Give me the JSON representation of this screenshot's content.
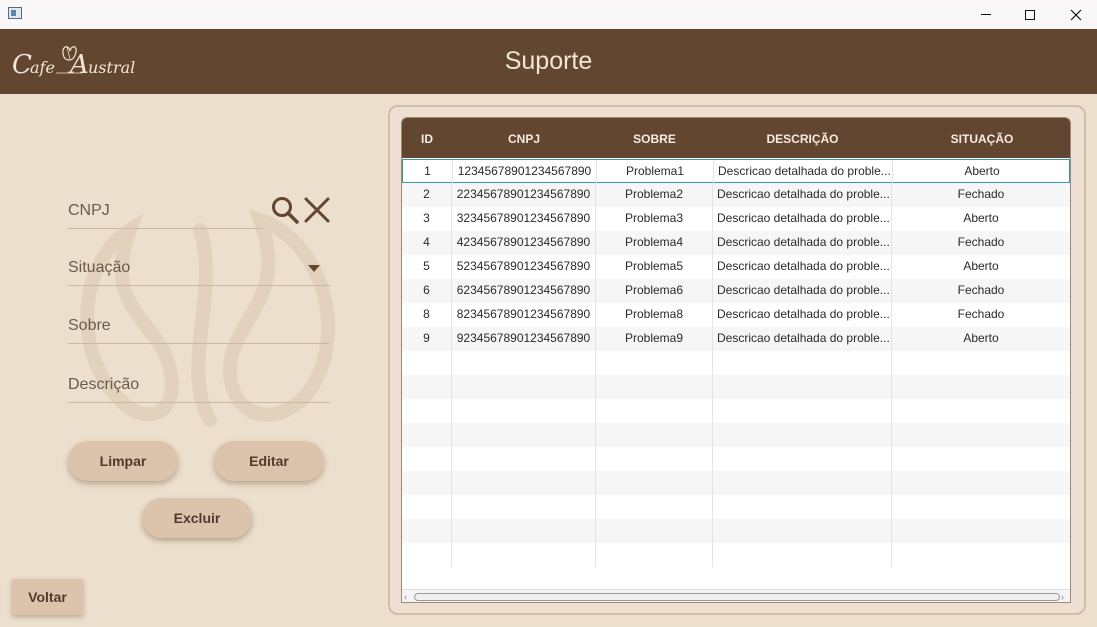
{
  "window": {
    "minimize_label": "Minimize",
    "maximize_label": "Maximize",
    "close_label": "Close"
  },
  "header": {
    "logo_text": "Cafe Austral",
    "title": "Suporte"
  },
  "form": {
    "cnpj_placeholder": "CNPJ",
    "situacao_placeholder": "Situação",
    "sobre_placeholder": "Sobre",
    "descricao_placeholder": "Descrição"
  },
  "buttons": {
    "limpar": "Limpar",
    "editar": "Editar",
    "excluir": "Excluir",
    "voltar": "Voltar"
  },
  "table": {
    "columns": [
      "ID",
      "CNPJ",
      "SOBRE",
      "DESCRIÇÃO",
      "SITUAÇÃO"
    ],
    "rows": [
      [
        "1",
        "12345678901234567890",
        "Problema1",
        "Descricao detalhada do proble...",
        "Aberto"
      ],
      [
        "2",
        "22345678901234567890",
        "Problema2",
        "Descricao detalhada do proble...",
        "Fechado"
      ],
      [
        "3",
        "32345678901234567890",
        "Problema3",
        "Descricao detalhada do proble...",
        "Aberto"
      ],
      [
        "4",
        "42345678901234567890",
        "Problema4",
        "Descricao detalhada do proble...",
        "Fechado"
      ],
      [
        "5",
        "52345678901234567890",
        "Problema5",
        "Descricao detalhada do proble...",
        "Aberto"
      ],
      [
        "6",
        "62345678901234567890",
        "Problema6",
        "Descricao detalhada do proble...",
        "Fechado"
      ],
      [
        "8",
        "82345678901234567890",
        "Problema8",
        "Descricao detalhada do proble...",
        "Fechado"
      ],
      [
        "9",
        "92345678901234567890",
        "Problema9",
        "Descricao detalhada do proble...",
        "Aberto"
      ]
    ],
    "selected_row": 0,
    "empty_rows": 9
  },
  "icons": {
    "search": "search-icon",
    "clear": "close-icon",
    "dropdown": "chevron-down-icon"
  },
  "colors": {
    "header_bg": "#634630",
    "panel_bg": "#eddfce",
    "button_bg": "#dcc4ac",
    "selection": "#3a9a9a"
  }
}
